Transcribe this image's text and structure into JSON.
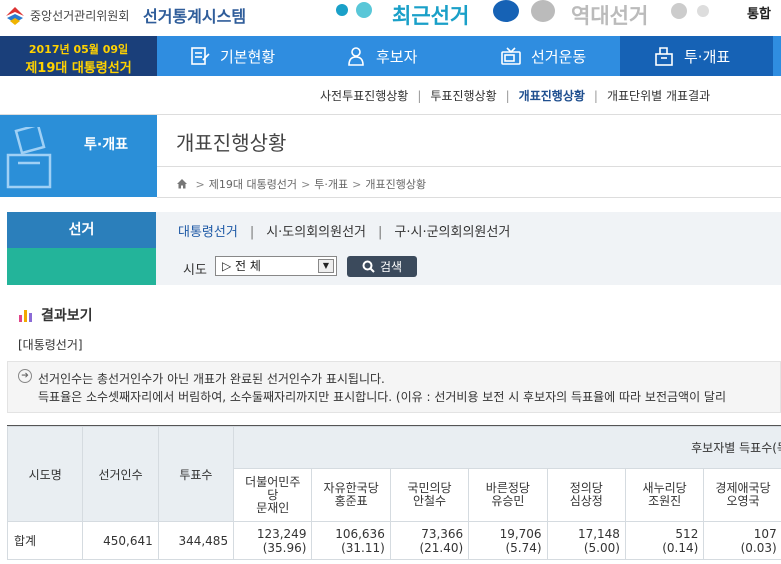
{
  "header": {
    "org_name": "중앙선거관리위원회",
    "system_name": "선거통계시스템",
    "recent_label": "최근선거",
    "past_label": "역대선거",
    "integrated_label": "통합"
  },
  "election_badge": {
    "date": "2017년 05월 09일",
    "name": "제19대 대통령선거"
  },
  "nav": {
    "items": [
      {
        "label": "기본현황",
        "icon": "document-edit-icon"
      },
      {
        "label": "후보자",
        "icon": "person-icon"
      },
      {
        "label": "선거운동",
        "icon": "tv-icon"
      },
      {
        "label": "투·개표",
        "icon": "ballot-box-icon"
      }
    ]
  },
  "subnav": {
    "items": [
      "사전투표진행상황",
      "투표진행상황",
      "개표진행상황",
      "개표단위별 개표결과"
    ]
  },
  "section": {
    "title": "투·개표",
    "page_title": "개표진행상황",
    "breadcrumb": [
      "제19대 대통령선거",
      "투·개표",
      "개표진행상황"
    ]
  },
  "search": {
    "left_label": "선거",
    "election_tabs": [
      "대통령선거",
      "시·도의회의원선거",
      "구·시·군의회의원선거"
    ],
    "sido_label": "시도",
    "sido_value": "▷ 전 체",
    "search_label": "검색"
  },
  "result": {
    "title": "결과보기",
    "subtitle": "[대통령선거]",
    "notice_1": "선거인수는 총선거인수가 아닌 개표가 완료된 선거인수가 표시됩니다.",
    "notice_2": "득표율은 소수셋째자리에서 버림하여, 소수둘째자리까지만 표시합니다. (이유 : 선거비용 보전 시 후보자의 득표율에 따라 보전금액이 달리"
  },
  "table": {
    "headers": {
      "region": "시도명",
      "electors": "선거인수",
      "voters": "투표수",
      "candidates_group": "후보자별 득표수(득표"
    },
    "candidates": [
      {
        "party": "더불어민주당",
        "name": "문재인"
      },
      {
        "party": "자유한국당",
        "name": "홍준표"
      },
      {
        "party": "국민의당",
        "name": "안철수"
      },
      {
        "party": "바른정당",
        "name": "유승민"
      },
      {
        "party": "정의당",
        "name": "심상정"
      },
      {
        "party": "새누리당",
        "name": "조원진"
      },
      {
        "party": "경제애국당",
        "name": "오영국"
      }
    ],
    "total_row": {
      "region": "합계",
      "electors": "450,641",
      "voters": "344,485",
      "votes": [
        {
          "count": "123,249",
          "rate": "(35.96)"
        },
        {
          "count": "106,636",
          "rate": "(31.11)"
        },
        {
          "count": "73,366",
          "rate": "(21.40)"
        },
        {
          "count": "19,706",
          "rate": "(5.74)"
        },
        {
          "count": "17,148",
          "rate": "(5.00)"
        },
        {
          "count": "512",
          "rate": "(0.14)"
        },
        {
          "count": "107",
          "rate": "(0.03)"
        }
      ]
    }
  }
}
